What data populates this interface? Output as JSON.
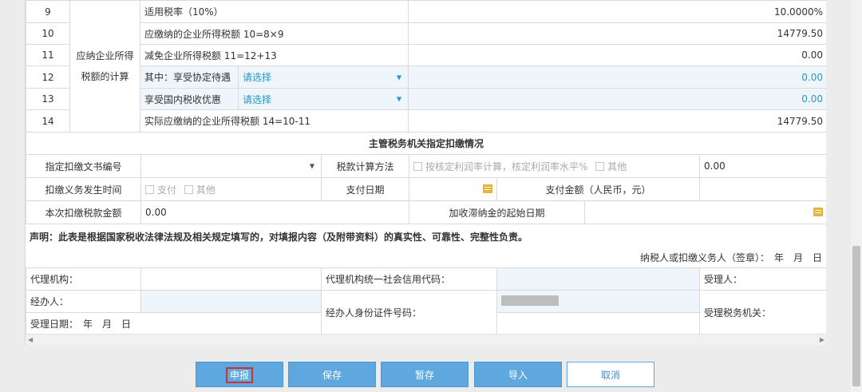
{
  "rows": [
    {
      "no": "9",
      "label": "适用税率（10%）",
      "value": "10.0000%"
    },
    {
      "no": "10",
      "label": "应缴纳的企业所得税额 10=8×9",
      "value": "14779.50"
    },
    {
      "no": "11",
      "label": "减免企业所得税额 11=12+13",
      "value": "0.00"
    },
    {
      "no": "12",
      "label": "其中：享受协定待遇",
      "select": "请选择",
      "value": "0.00"
    },
    {
      "no": "13",
      "label": "享受国内税收优惠",
      "select": "请选择",
      "value": "0.00"
    },
    {
      "no": "14",
      "label": "实际应缴纳的企业所得税额 14=10-11",
      "value": "14779.50"
    }
  ],
  "group_label": "应纳企业所得税额的计算",
  "withholding": {
    "title": "主管税务机关指定扣缴情况",
    "doc_no_label": "指定扣缴文书编号",
    "tax_method_label": "税款计算方法",
    "tax_method_opt1": "按核定利润率计算，核定利润率水平%",
    "tax_method_opt2": "其他",
    "tax_method_value": "0.00",
    "occur_label": "扣缴义务发生时间",
    "occur_opt1": "支付",
    "occur_opt2": "其他",
    "pay_date_label": "支付日期",
    "pay_amount_label": "支付金额（人民币，元）",
    "this_amount_label": "本次扣缴税款金额",
    "this_amount_value": "0.00",
    "late_fee_label": "加收滞纳金的起始日期"
  },
  "declaration": "声明：此表是根据国家税收法律法规及相关规定填写的，对填报内容（及附带资料）的真实性、可靠性、完整性负责。",
  "signature": "纳税人或扣缴义务人（签章）：　年　月　日",
  "agent": {
    "agency_label": "代理机构：",
    "credit_code_label": "代理机构统一社会信用代码：",
    "receiver_label": "受理人：",
    "handler_label": "经办人：",
    "handler_id_label": "经办人身份证件号码：",
    "receive_office_label": "受理税务机关：",
    "receive_date_label": "受理日期：　年　月　日"
  },
  "buttons": {
    "declare": "申报",
    "save": "保存",
    "temp_save": "暂存",
    "import": "导入",
    "cancel": "取消"
  },
  "colors": {
    "primary": "#5fa8df",
    "highlight": "#d0312d",
    "link": "#2a97c8"
  }
}
